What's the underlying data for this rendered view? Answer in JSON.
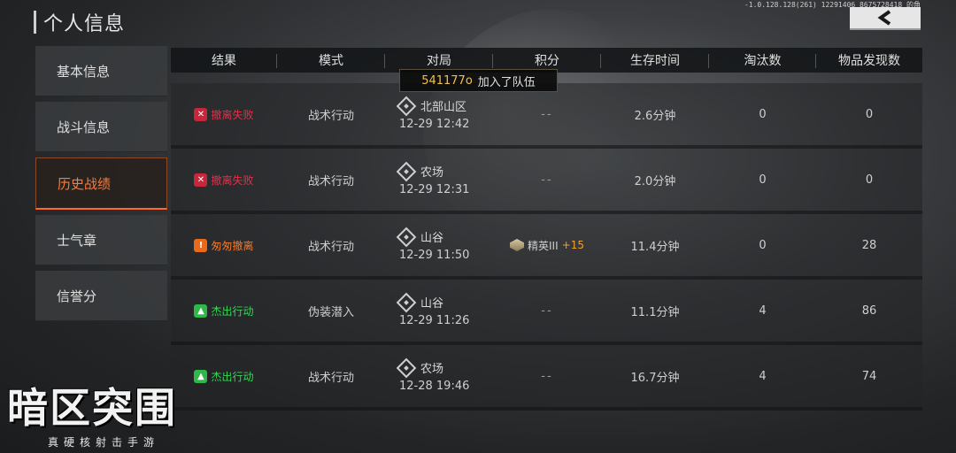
{
  "debug_text": "-1.0.128.128(261) 12291406 8675728418 的角",
  "title": "个人信息",
  "back_icon": "chevron-left-icon",
  "sidebar": {
    "items": [
      {
        "label": "基本信息",
        "active": false
      },
      {
        "label": "战斗信息",
        "active": false
      },
      {
        "label": "历史战绩",
        "active": true
      },
      {
        "label": "士气章",
        "active": false
      },
      {
        "label": "信誉分",
        "active": false
      }
    ]
  },
  "table": {
    "headers": [
      "结果",
      "模式",
      "对局",
      "积分",
      "生存时间",
      "淘汰数",
      "物品发现数"
    ],
    "rows": [
      {
        "result": "撤离失败",
        "result_type": "fail",
        "result_icon": "x-icon",
        "mode": "战术行动",
        "map": "北部山区",
        "time": "12-29 12:42",
        "score": "--",
        "survival": "2.6分钟",
        "kills": "0",
        "items": "0"
      },
      {
        "result": "撤离失败",
        "result_type": "fail",
        "result_icon": "x-icon",
        "mode": "战术行动",
        "map": "农场",
        "time": "12-29 12:31",
        "score": "--",
        "survival": "2.0分钟",
        "kills": "0",
        "items": "0"
      },
      {
        "result": "匆匆撤离",
        "result_type": "rush",
        "result_icon": "warning-icon",
        "mode": "战术行动",
        "map": "山谷",
        "time": "12-29 11:50",
        "score_rank": "精英III",
        "score_plus": "+15",
        "survival": "11.4分钟",
        "kills": "0",
        "items": "28"
      },
      {
        "result": "杰出行动",
        "result_type": "great",
        "result_icon": "thumbs-up-icon",
        "mode": "伪装潜入",
        "map": "山谷",
        "time": "12-29 11:26",
        "score": "--",
        "survival": "11.1分钟",
        "kills": "4",
        "items": "86"
      },
      {
        "result": "杰出行动",
        "result_type": "great",
        "result_icon": "thumbs-up-icon",
        "mode": "战术行动",
        "map": "农场",
        "time": "12-28 19:46",
        "score": "--",
        "survival": "16.7分钟",
        "kills": "4",
        "items": "74"
      }
    ]
  },
  "toast": {
    "name": "541177o",
    "message": "加入了队伍"
  },
  "logo": {
    "main": "暗区突围",
    "sub": "真硬核射击手游"
  }
}
